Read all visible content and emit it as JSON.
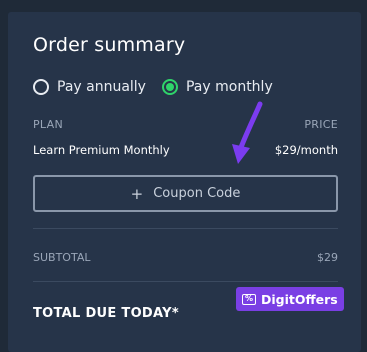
{
  "summary": {
    "title": "Order summary",
    "billing": {
      "annual_label": "Pay annually",
      "monthly_label": "Pay monthly",
      "selected": "monthly"
    },
    "columns": {
      "plan": "PLAN",
      "price": "PRICE"
    },
    "plan": {
      "name": "Learn Premium Monthly",
      "price": "$29/month"
    },
    "coupon": {
      "label": "Coupon Code",
      "icon": "plus-icon"
    },
    "subtotal": {
      "label": "SUBTOTAL",
      "value": "$29"
    },
    "total": {
      "label": "TOTAL DUE TODAY*"
    }
  },
  "watermark": {
    "text": "DigitOffers",
    "icon": "coupon-tag-icon"
  },
  "colors": {
    "background": "#1f2a38",
    "card": "#263449",
    "accent_green": "#2fd46a",
    "watermark_purple": "#7a3fe4",
    "arrow_purple": "#7b3cf0"
  }
}
